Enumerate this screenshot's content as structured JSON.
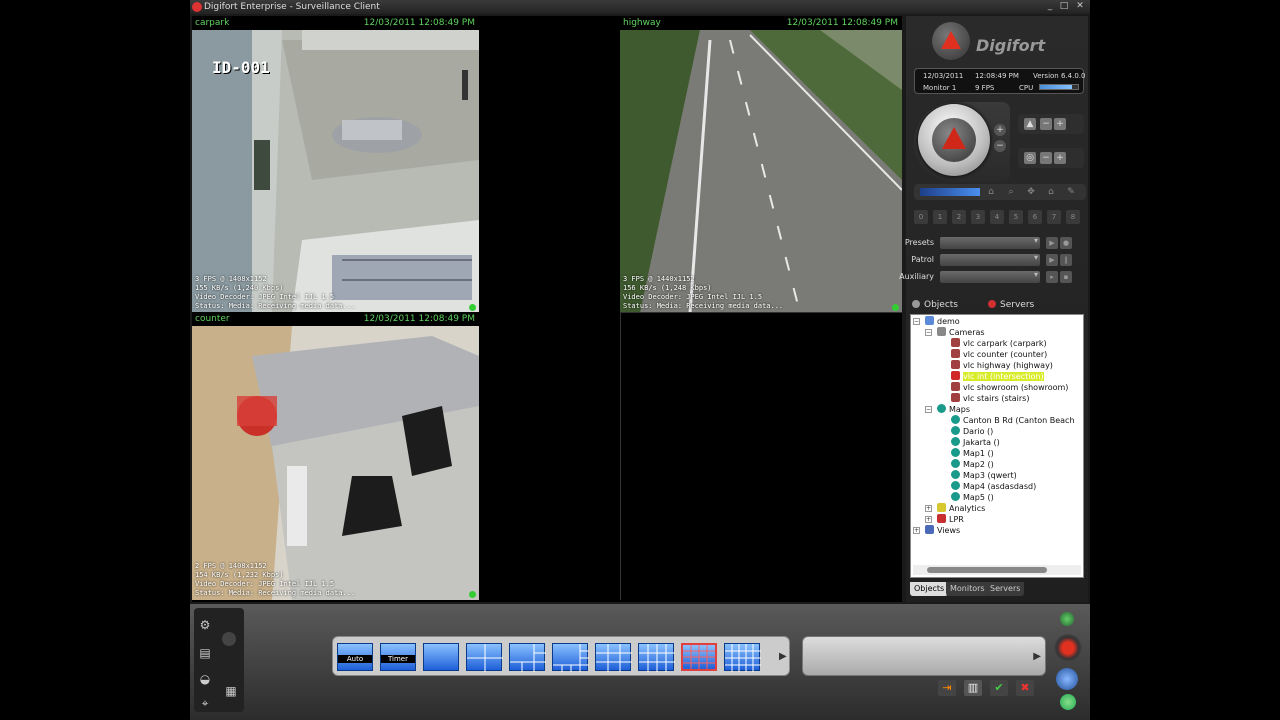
{
  "window": {
    "title": "Digifort Enterprise - Surveillance Client"
  },
  "cameras": [
    {
      "name": "carpark",
      "timestamp": "12/03/2011 12:08:49 PM",
      "camera_id": "ID-001",
      "overlay": [
        "3 FPS @ 1408x1152",
        "155 KB/s (1,240 Kbps)",
        "Video Decoder: JPEG Intel IJL 1.5",
        "Status: Media: Receiving media data..."
      ]
    },
    {
      "name": "highway",
      "timestamp": "12/03/2011 12:08:49 PM",
      "overlay": [
        "3 FPS @ 1440x1152",
        "156 KB/s (1,248 Kbps)",
        "Video Decoder: JPEG Intel IJL 1.5",
        "Status: Media: Receiving media data..."
      ]
    },
    {
      "name": "counter",
      "timestamp": "12/03/2011 12:08:49 PM",
      "overlay": [
        "2 FPS @ 1408x1152",
        "154 KB/s (1,232 Kbps)",
        "Video Decoder: JPEG Intel IJL 1.5",
        "Status: Media: Receiving media data..."
      ]
    }
  ],
  "info": {
    "date": "12/03/2011",
    "time": "12:08:49 PM",
    "version": "Version 6.4.0.0",
    "monitor": "Monitor 1",
    "fps": "9 FPS",
    "cpu_label": "CPU",
    "cpu_level": 0.85
  },
  "logo": {
    "text": "Digifort"
  },
  "digits": [
    "0",
    "1",
    "2",
    "3",
    "4",
    "5",
    "6",
    "7",
    "8"
  ],
  "controls": {
    "presets": "Presets",
    "patrol": "Patrol",
    "auxiliary": "Auxiliary"
  },
  "tree_header": {
    "objects": "Objects",
    "servers": "Servers"
  },
  "tree": {
    "root": "demo",
    "cameras_label": "Cameras",
    "cameras": [
      "vlc carpark (carpark)",
      "vlc counter (counter)",
      "vlc highway (highway)",
      "vlc int (intersection)",
      "vlc showroom (showroom)",
      "vlc stairs (stairs)"
    ],
    "maps_label": "Maps",
    "maps": [
      "Canton B Rd (Canton Beach",
      "Dario ()",
      "Jakarta ()",
      "Map1 ()",
      "Map2 ()",
      "Map3 (qwert)",
      "Map4 (asdasdasd)",
      "Map5 ()"
    ],
    "analytics": "Analytics",
    "lpr": "LPR",
    "views": "Views"
  },
  "bottom_tabs": [
    "Objects",
    "Monitors",
    "Servers"
  ],
  "layouts": {
    "auto": "Auto",
    "timer": "Timer"
  },
  "colors": {
    "accent": "#e03020",
    "osd_green": "#5fd35f",
    "selection": "#3078e8"
  }
}
